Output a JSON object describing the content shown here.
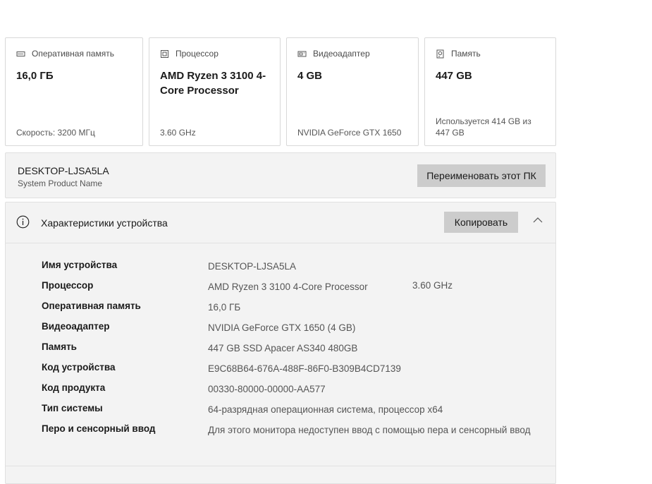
{
  "cards": [
    {
      "icon": "ram-icon",
      "title": "Оперативная память",
      "value": "16,0 ГБ",
      "sub": "Скорость: 3200 МГц"
    },
    {
      "icon": "cpu-icon",
      "title": "Процессор",
      "value": "AMD Ryzen 3 3100 4-Core Processor",
      "sub": "3.60 GHz"
    },
    {
      "icon": "gpu-icon",
      "title": "Видеоадаптер",
      "value": "4 GB",
      "sub": "NVIDIA GeForce GTX 1650"
    },
    {
      "icon": "storage-icon",
      "title": "Память",
      "value": "447 GB",
      "sub": "Используется 414 GB из 447 GB"
    }
  ],
  "device": {
    "name": "DESKTOP-LJSA5LA",
    "model": "System Product Name",
    "rename_label": "Переименовать этот ПК"
  },
  "specs": {
    "title": "Характеристики устройства",
    "copy_label": "Копировать",
    "rows": [
      {
        "label": "Имя устройства",
        "value": "DESKTOP-LJSA5LA",
        "extra": ""
      },
      {
        "label": "Процессор",
        "value": "AMD Ryzen 3 3100 4-Core Processor",
        "extra": "3.60 GHz"
      },
      {
        "label": "Оперативная память",
        "value": "16,0 ГБ",
        "extra": ""
      },
      {
        "label": "Видеоадаптер",
        "value": "NVIDIA GeForce GTX 1650 (4 GB)",
        "extra": ""
      },
      {
        "label": "Память",
        "value": "447 GB SSD Apacer AS340 480GB",
        "extra": ""
      },
      {
        "label": "Код устройства",
        "value": "E9C68B64-676A-488F-86F0-B309B4CD7139",
        "extra": ""
      },
      {
        "label": "Код продукта",
        "value": "00330-80000-00000-AA577",
        "extra": ""
      },
      {
        "label": "Тип системы",
        "value": "64-разрядная операционная система, процессор x64",
        "extra": ""
      },
      {
        "label": "Перо и сенсорный ввод",
        "value": "Для этого монитора недоступен ввод с помощью пера и сенсорный ввод",
        "extra": ""
      }
    ]
  }
}
